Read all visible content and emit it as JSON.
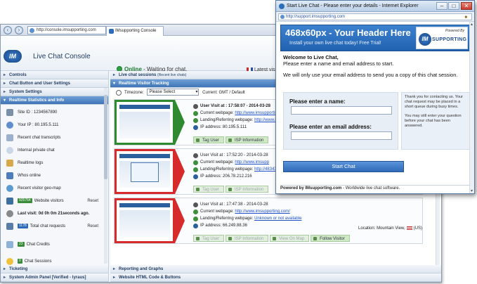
{
  "back_window": {
    "address": "http://console.imsupporting.com",
    "tab_label": "IMsupporting Console",
    "logo_text": "IM",
    "app_title": "Live Chat Console",
    "status_label": "Online",
    "status_detail": " - Waiting for chat.",
    "latest_visitor": "Latest visitor",
    "sidebar": {
      "sections": [
        {
          "label": "Controls"
        },
        {
          "label": "Chat Button and User Settings"
        },
        {
          "label": "System Settings"
        },
        {
          "label": "Realtime Statistics and Info"
        }
      ],
      "items": [
        {
          "label": "Site ID : 1234567890"
        },
        {
          "label": "Your IP : 80.195.5.111"
        },
        {
          "label": "Recent chat transcripts"
        },
        {
          "label": "Internal private chat"
        },
        {
          "label": "Realtime logs"
        },
        {
          "label": "Whos online"
        },
        {
          "label": "Recent visitor geo-map"
        }
      ],
      "website_visitors": {
        "count": "925764",
        "label": "Website visitors",
        "reset": "Reset"
      },
      "last_visit": {
        "prefix": "Last visit: ",
        "value": "0d 0h 0m 21seconds ago."
      },
      "total_chat": {
        "count": "1178",
        "label": "Total chat requests",
        "reset": "Reset"
      },
      "chat_credits": {
        "count": "23",
        "label": "Chat Credits"
      },
      "chat_sessions": {
        "count": "0",
        "label": "Chat Sessions"
      },
      "bottom_sections": [
        {
          "label": "Ticketing"
        },
        {
          "label": "System Admin Panel [Verified - lyraus]"
        }
      ]
    },
    "main": {
      "chat_sessions_header": "Live chat sessions",
      "chat_sessions_sub": "(Recent live chats)",
      "tracking_header": "Realtime Visitor Tracking",
      "timezone_label": "Timezone:",
      "timezone_value": "Please Select",
      "timezone_current": "Current: GMT / Default",
      "visitors": [
        {
          "visit_label": "User Visit at : 17:58:07 - 2014-03-28",
          "webpage_label": "Current webpage: ",
          "webpage_value": "http://www.imsupporting.com",
          "landing_label": "Landing/Referring webpage: ",
          "landing_value": "http://www.ims",
          "ip_label": "IP address: 80.195.5.111",
          "actions": [
            {
              "label": "Tag User"
            },
            {
              "label": "ISP Information"
            }
          ]
        },
        {
          "visit_label": "User Visit at : 17:52:20 - 2014-03-28",
          "webpage_label": "Current webpage: ",
          "webpage_value": "http://www.imsupp",
          "landing_label": "Landing/Referring webpage: ",
          "landing_value": "http://48343.1",
          "ip_label": "IP address: 206.78.212.216",
          "actions": [
            {
              "label": "Tag User"
            },
            {
              "label": "ISP Information"
            }
          ]
        },
        {
          "visit_label": "User Visit at : 17:47:38 - 2014-03-28",
          "webpage_label": "Current webpage: ",
          "webpage_value": "http://www.imsupporting.com/",
          "landing_label": "Landing/Referring webpage: ",
          "landing_value": "Unknown or not available",
          "ip_label": "IP address: 66.249.88.36",
          "location_label": "Location: Mountain View,",
          "location_country": "(US)",
          "actions": [
            {
              "label": "Tag User"
            },
            {
              "label": "ISP Information"
            },
            {
              "label": "View On Map"
            },
            {
              "label": "Follow Visitor"
            }
          ]
        }
      ],
      "bottom_sections": [
        {
          "label": "Reporting and Graphs"
        },
        {
          "label": "Website HTML Code & Buttons"
        }
      ]
    }
  },
  "front_window": {
    "title": "Start Live Chat - Please enter your details - Internet Explorer",
    "controls": {
      "minimize": "–",
      "maximize": "□",
      "close": "✕"
    },
    "address": "http://support.imsupporting.com",
    "banner_title": "468x60px - Your Header Here",
    "banner_subtitle": "Install your own live chat today! Free Trial!",
    "logo": {
      "powered_by": "Powered By",
      "circle": "IM",
      "name": "SUPPORTING"
    },
    "welcome_title": "Welcome to Live Chat,",
    "welcome_line2": "Please enter a name and email address to start.",
    "welcome_line3": "We will only use your email address to send you a copy of this chat session.",
    "name_label": "Please enter a name:",
    "email_label": "Please enter an email address:",
    "side_note_1": "Thank you for contacting us. Your chat request may be placed in a short queue during busy times.",
    "side_note_2": "You may still enter your question before your chat has been answered.",
    "start_button": "Start Chat",
    "footer_brand": "Powered by",
    "footer_link": "IMsupporting.com",
    "footer_rest": " - Worldwide live chat software."
  },
  "colors": {
    "accent": "#3f74b6",
    "online": "#2ea043",
    "visitor_active": "#2f8a2f",
    "visitor_idle": "#d72a2a"
  }
}
